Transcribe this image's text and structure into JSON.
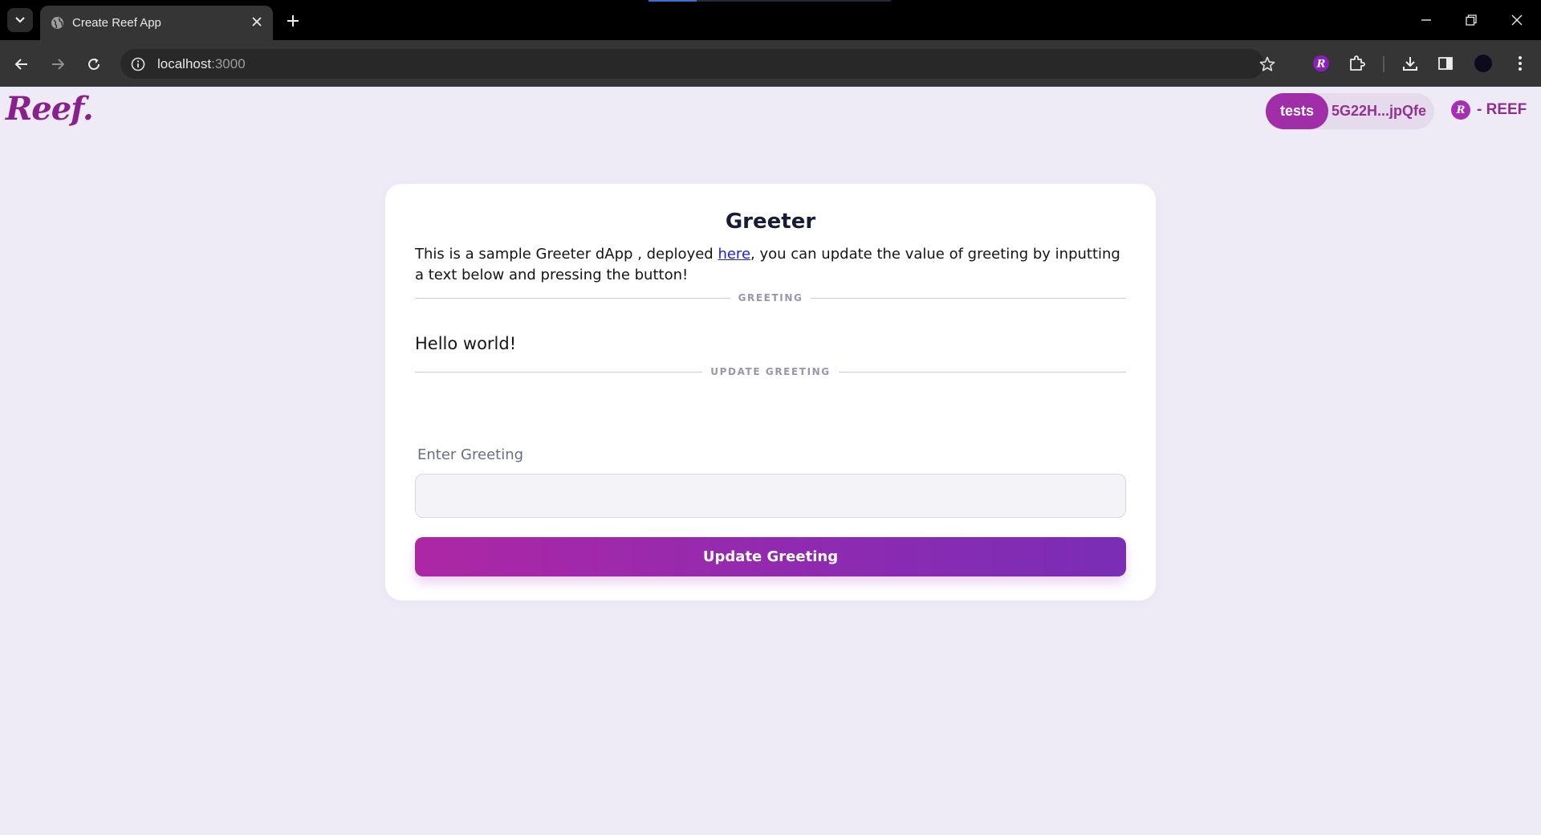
{
  "browser": {
    "tab_title": "Create Reef App",
    "url_host": "localhost",
    "url_port": ":3000"
  },
  "header": {
    "logo_text": "Reef.",
    "account_name": "tests",
    "account_address": "5G22H...jpQfe",
    "balance_text": "- REEF",
    "coin_symbol": "R"
  },
  "card": {
    "title": "Greeter",
    "description_before_link": "This is a sample Greeter dApp , deployed ",
    "description_link": "here",
    "description_after_link": ", you can update the value of greeting by inputting a text below and pressing the button!",
    "greeting_divider": "GREETING",
    "greeting_value": "Hello world!",
    "update_divider": "UPDATE GREETING",
    "input_label": "Enter Greeting",
    "input_value": "",
    "button_label": "Update Greeting"
  },
  "colors": {
    "brand": "#8a1f8e",
    "button_gradient_start": "#ad27a5",
    "button_gradient_end": "#7a2db6",
    "page_background": "#efebf6",
    "link": "#1f1fd6"
  },
  "icons": {
    "tab_list": "chevron-down-icon",
    "favicon": "globe-icon",
    "tab_close": "close-icon",
    "new_tab": "plus-icon",
    "back": "arrow-left-icon",
    "forward": "arrow-right-icon",
    "reload": "reload-icon",
    "site_info": "info-icon",
    "bookmark": "star-icon",
    "reef_extension": "reef-extension-icon",
    "extensions": "puzzle-icon",
    "downloads": "download-icon",
    "side_panel": "side-panel-icon",
    "profile": "profile-avatar-icon",
    "menu": "kebab-menu-icon"
  }
}
